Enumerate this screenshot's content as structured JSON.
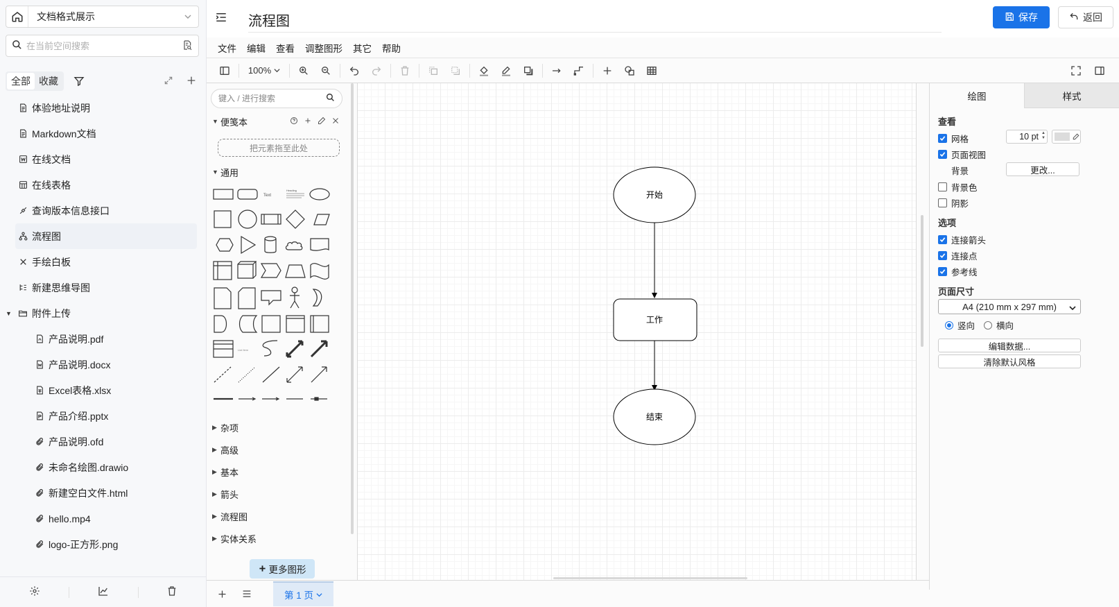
{
  "sidebar": {
    "space_name": "文档格式展示",
    "search_placeholder": "在当前空间搜索",
    "tab_all": "全部",
    "tab_fav": "收藏",
    "items": [
      {
        "label": "体验地址说明",
        "icon": "doc-icon"
      },
      {
        "label": "Markdown文档",
        "icon": "doc-icon"
      },
      {
        "label": "在线文档",
        "icon": "word-icon"
      },
      {
        "label": "在线表格",
        "icon": "sheet-icon"
      },
      {
        "label": "查询版本信息接口",
        "icon": "api-icon"
      },
      {
        "label": "流程图",
        "icon": "flowchart-icon"
      },
      {
        "label": "手绘白板",
        "icon": "whiteboard-icon"
      },
      {
        "label": "新建思维导图",
        "icon": "mindmap-icon"
      },
      {
        "label": "附件上传",
        "icon": "folder-icon"
      }
    ],
    "children": [
      {
        "label": "产品说明.pdf",
        "icon": "pdf-icon"
      },
      {
        "label": "产品说明.docx",
        "icon": "word-icon"
      },
      {
        "label": "Excel表格.xlsx",
        "icon": "excel-icon"
      },
      {
        "label": "产品介绍.pptx",
        "icon": "ppt-icon"
      },
      {
        "label": "产品说明.ofd",
        "icon": "attachment-icon"
      },
      {
        "label": "未命名绘图.drawio",
        "icon": "attachment-icon"
      },
      {
        "label": "新建空白文件.html",
        "icon": "attachment-icon"
      },
      {
        "label": "hello.mp4",
        "icon": "attachment-icon"
      },
      {
        "label": "logo-正方形.png",
        "icon": "attachment-icon"
      }
    ]
  },
  "header": {
    "title": "流程图",
    "save_label": "保存",
    "back_label": "返回"
  },
  "menubar": [
    "文件",
    "编辑",
    "查看",
    "调整图形",
    "其它",
    "帮助"
  ],
  "toolbar": {
    "zoom": "100%"
  },
  "shapes": {
    "search_placeholder": "键入 / 进行搜索",
    "scratchpad_title": "便笺本",
    "scratchpad_drop": "把元素拖至此处",
    "general_title": "通用",
    "text_label": "Text",
    "heading_label": "Heading",
    "list_label": "List Item",
    "collapsed_sections": [
      "杂项",
      "高级",
      "基本",
      "箭头",
      "流程图",
      "实体关系"
    ],
    "more_shapes": "更多图形"
  },
  "diagram": {
    "nodes": [
      {
        "id": "start",
        "label": "开始",
        "shape": "ellipse"
      },
      {
        "id": "work",
        "label": "工作",
        "shape": "rounded-rectangle"
      },
      {
        "id": "end",
        "label": "结束",
        "shape": "ellipse"
      }
    ],
    "edges": [
      {
        "from": "start",
        "to": "work"
      },
      {
        "from": "work",
        "to": "end"
      }
    ]
  },
  "format_panel": {
    "tab_diagram": "绘图",
    "tab_style": "样式",
    "view_heading": "查看",
    "grid_label": "网格",
    "grid_size": "10 pt",
    "page_view_label": "页面视图",
    "background_label": "背景",
    "change_button": "更改...",
    "bg_color_label": "背景色",
    "shadow_label": "阴影",
    "options_heading": "选项",
    "connection_arrows": "连接箭头",
    "connection_points": "连接点",
    "guides": "参考线",
    "page_size_heading": "页面尺寸",
    "page_size_value": "A4 (210 mm x 297 mm)",
    "portrait": "竖向",
    "landscape": "横向",
    "edit_data": "编辑数据...",
    "clear_style": "清除默认风格",
    "checks": {
      "grid": true,
      "page_view": true,
      "bg_color": false,
      "shadow": false,
      "arrows": true,
      "points": true,
      "guides": true
    },
    "orientation": "portrait"
  },
  "pagebar": {
    "page_tab": "第 1 页"
  },
  "colors": {
    "accent": "#1a73e8",
    "page_tab_bg": "#dfeaf7",
    "more_shapes_bg": "#cfe6f7"
  }
}
